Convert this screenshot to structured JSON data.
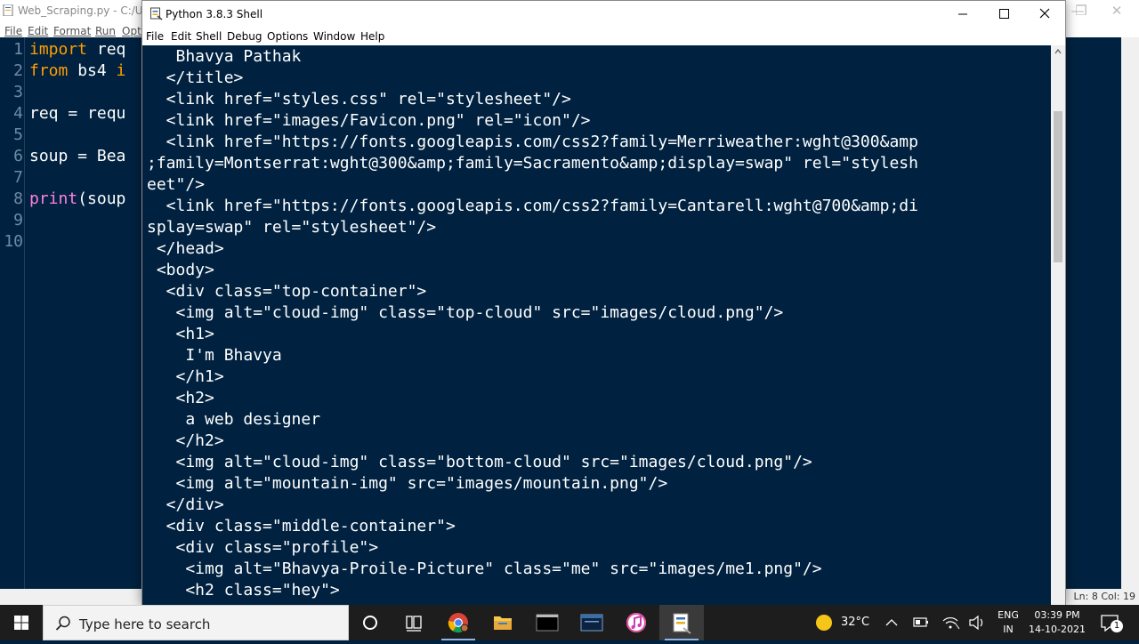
{
  "bg_window": {
    "title": "Web_Scraping.py - C:/User",
    "menu": [
      "File",
      "Edit",
      "Format",
      "Run",
      "Opti"
    ],
    "line_numbers": [
      "1",
      "2",
      "3",
      "4",
      "5",
      "6",
      "7",
      "8",
      "9",
      "10"
    ],
    "code": {
      "l1_kw": "import",
      "l1_rest": " req",
      "l2_kw1": "from",
      "l2_rest": " bs4 ",
      "l2_kw2": "i",
      "l4": "req = requ",
      "l6": "soup = Bea",
      "l8_bi": "print",
      "l8_rest": "(soup"
    },
    "status": "Ln: 8  Col: 19"
  },
  "shell": {
    "title": "Python 3.8.3 Shell",
    "menu": [
      "File",
      "Edit",
      "Shell",
      "Debug",
      "Options",
      "Window",
      "Help"
    ],
    "lines": [
      "   Bhavya Pathak",
      "  </title>",
      "  <link href=\"styles.css\" rel=\"stylesheet\"/>",
      "  <link href=\"images/Favicon.png\" rel=\"icon\"/>",
      "  <link href=\"https://fonts.googleapis.com/css2?family=Merriweather:wght@300&amp",
      ";family=Montserrat:wght@300&amp;family=Sacramento&amp;display=swap\" rel=\"stylesh",
      "eet\"/>",
      "  <link href=\"https://fonts.googleapis.com/css2?family=Cantarell:wght@700&amp;di",
      "splay=swap\" rel=\"stylesheet\"/>",
      " </head>",
      " <body>",
      "  <div class=\"top-container\">",
      "   <img alt=\"cloud-img\" class=\"top-cloud\" src=\"images/cloud.png\"/>",
      "   <h1>",
      "    I'm Bhavya",
      "   </h1>",
      "   <h2>",
      "    a web designer",
      "   </h2>",
      "   <img alt=\"cloud-img\" class=\"bottom-cloud\" src=\"images/cloud.png\"/>",
      "   <img alt=\"mountain-img\" src=\"images/mountain.png\"/>",
      "  </div>",
      "  <div class=\"middle-container\">",
      "   <div class=\"profile\">",
      "    <img alt=\"Bhavya-Proile-Picture\" class=\"me\" src=\"images/me1.png\"/>",
      "    <h2 class=\"hey\">"
    ]
  },
  "taskbar": {
    "search_placeholder": "Type here to search",
    "temperature": "32°C",
    "lang_line1": "ENG",
    "lang_line2": "IN",
    "time": "03:39 PM",
    "date": "14-10-2021",
    "notification_count": "1"
  },
  "colors": {
    "editor_bg": "#002240",
    "keyword": "#ff9d00",
    "builtin": "#ff80e1"
  }
}
